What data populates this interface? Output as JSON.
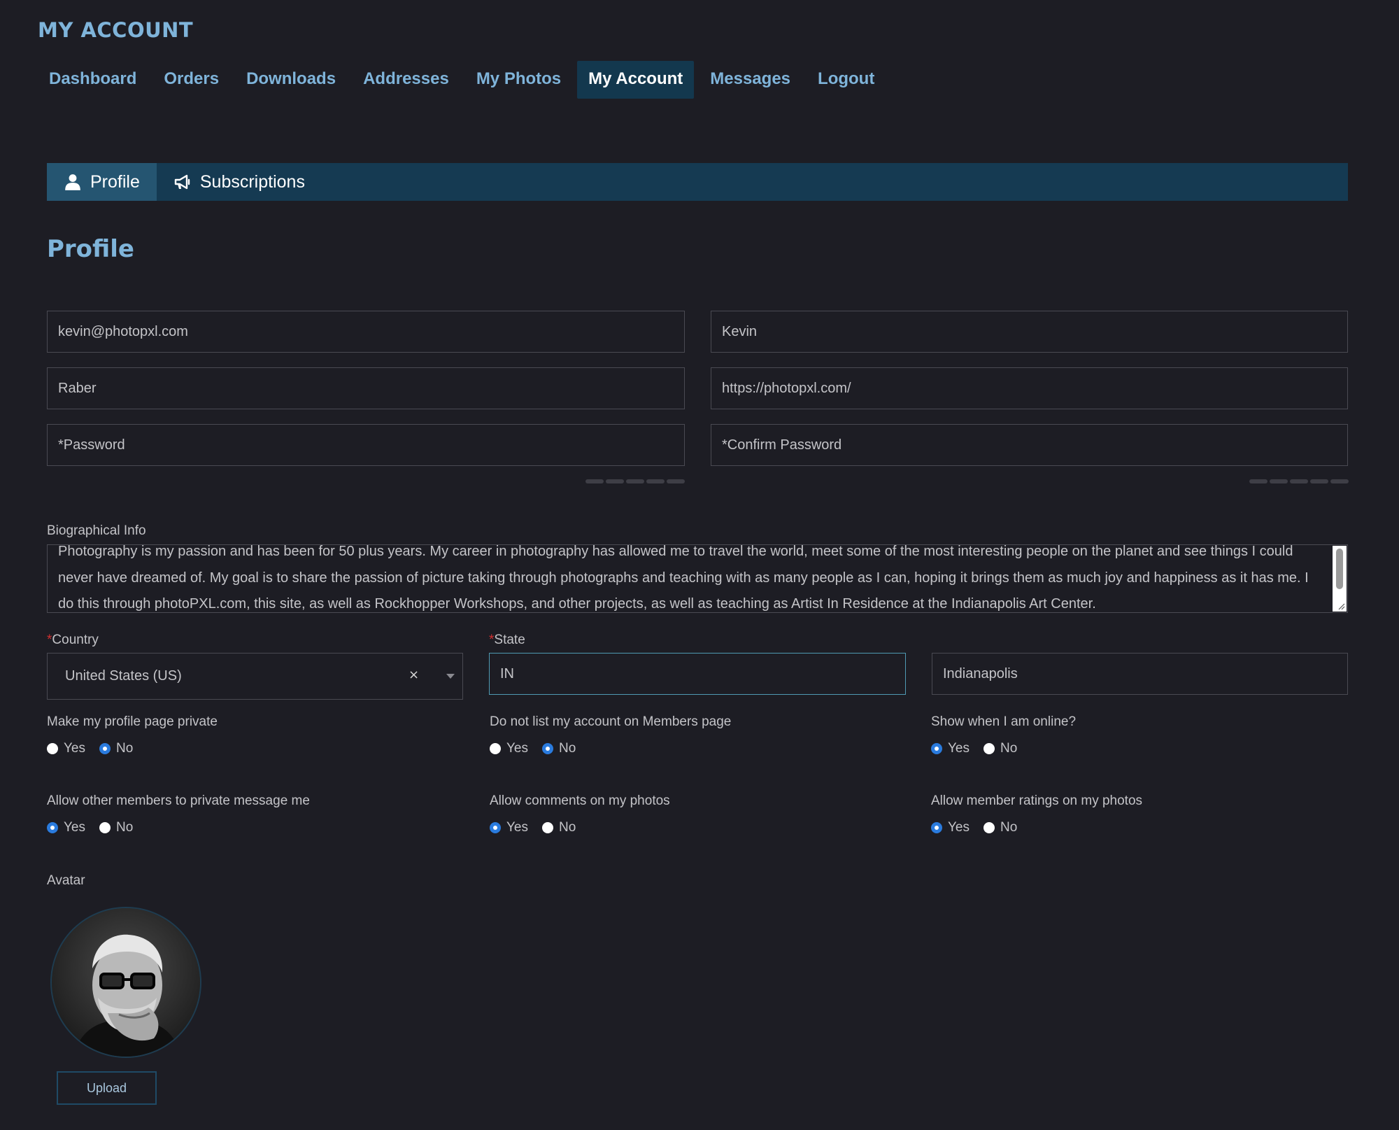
{
  "header": {
    "title": "MY ACCOUNT",
    "nav": [
      {
        "label": "Dashboard",
        "active": false
      },
      {
        "label": "Orders",
        "active": false
      },
      {
        "label": "Downloads",
        "active": false
      },
      {
        "label": "Addresses",
        "active": false
      },
      {
        "label": "My Photos",
        "active": false
      },
      {
        "label": "My Account",
        "active": true
      },
      {
        "label": "Messages",
        "active": false
      },
      {
        "label": "Logout",
        "active": false
      }
    ]
  },
  "tabs": [
    {
      "label": "Profile",
      "icon": "user-icon",
      "active": true
    },
    {
      "label": "Subscriptions",
      "icon": "megaphone-icon",
      "active": false
    }
  ],
  "section_title": "Profile",
  "form": {
    "email": "kevin@photopxl.com",
    "first_name": "Kevin",
    "last_name": "Raber",
    "website": "https://photopxl.com/",
    "password_placeholder": "*Password",
    "confirm_password_placeholder": "*Confirm Password",
    "bio_label": "Biographical Info",
    "bio_text": "Photography is my passion and has been for 50 plus years. My career in photography has allowed me to travel the world, meet some of the most interesting people on the planet and see things I could never have dreamed of. My goal is to share the passion of picture taking through photographs and teaching with as many people as I can, hoping it brings them as much joy and happiness as it has me. I do this through photoPXL.com, this site, as well as Rockhopper Workshops, and other projects, as well as teaching as Artist In Residence at the Indianapolis Art Center.",
    "country_label": "Country",
    "country_value": "United States (US)",
    "state_label": "State",
    "state_value": "IN",
    "city_value": "Indianapolis",
    "required_mark": "*",
    "clear_symbol": "×"
  },
  "options": [
    {
      "label": "Make my profile page private",
      "yes": "Yes",
      "no": "No",
      "selected": "No"
    },
    {
      "label": "Do not list my account on Members page",
      "yes": "Yes",
      "no": "No",
      "selected": "No"
    },
    {
      "label": "Show when I am online?",
      "yes": "Yes",
      "no": "No",
      "selected": "Yes"
    },
    {
      "label": "Allow other members to private message me",
      "yes": "Yes",
      "no": "No",
      "selected": "Yes"
    },
    {
      "label": "Allow comments on my photos",
      "yes": "Yes",
      "no": "No",
      "selected": "Yes"
    },
    {
      "label": "Allow member ratings on my photos",
      "yes": "Yes",
      "no": "No",
      "selected": "Yes"
    }
  ],
  "avatar": {
    "label": "Avatar",
    "upload_label": "Upload"
  },
  "colors": {
    "background": "#1d1d24",
    "accent": "#7fb4da",
    "tab_bar": "#153a52",
    "radio_selected": "#2a7bde",
    "required": "#d23030"
  }
}
